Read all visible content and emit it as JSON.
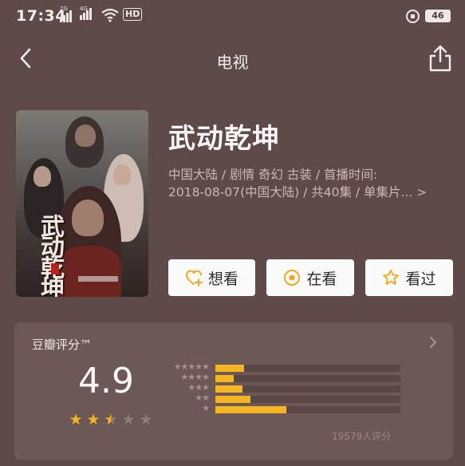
{
  "status_bar": {
    "time": "17:34",
    "sim1_type": "2G",
    "sim2_type": "4G",
    "volte": "HD",
    "battery": "46"
  },
  "nav": {
    "title": "电视"
  },
  "poster": {
    "title_text": "武动乾坤"
  },
  "show": {
    "title": "武动乾坤",
    "meta_line1": "中国大陆 / 剧情 奇幻 古装 / 首播时间:",
    "meta_line2": "2018-08-07(中国大陆) / 共40集 / 单集片..."
  },
  "actions": [
    {
      "label": "想看",
      "icon": "heart-plus-icon"
    },
    {
      "label": "在看",
      "icon": "target-icon"
    },
    {
      "label": "看过",
      "icon": "star-outline-icon"
    }
  ],
  "rating": {
    "label": "豆瓣评分™",
    "score": "4.9",
    "stars_value": 2.5,
    "stars_max": 5,
    "count": "19579人评分",
    "distribution": [
      {
        "stars": 5,
        "label": "★★★★★",
        "fraction": 0.155
      },
      {
        "stars": 4,
        "label": "★★★★",
        "fraction": 0.1
      },
      {
        "stars": 3,
        "label": "★★★",
        "fraction": 0.145
      },
      {
        "stars": 2,
        "label": "★★",
        "fraction": 0.19
      },
      {
        "stars": 1,
        "label": "★",
        "fraction": 0.385
      }
    ],
    "colors": {
      "accent": "#f5b422",
      "inactive_star": "#8f7b79",
      "track": "#5b4846"
    }
  }
}
